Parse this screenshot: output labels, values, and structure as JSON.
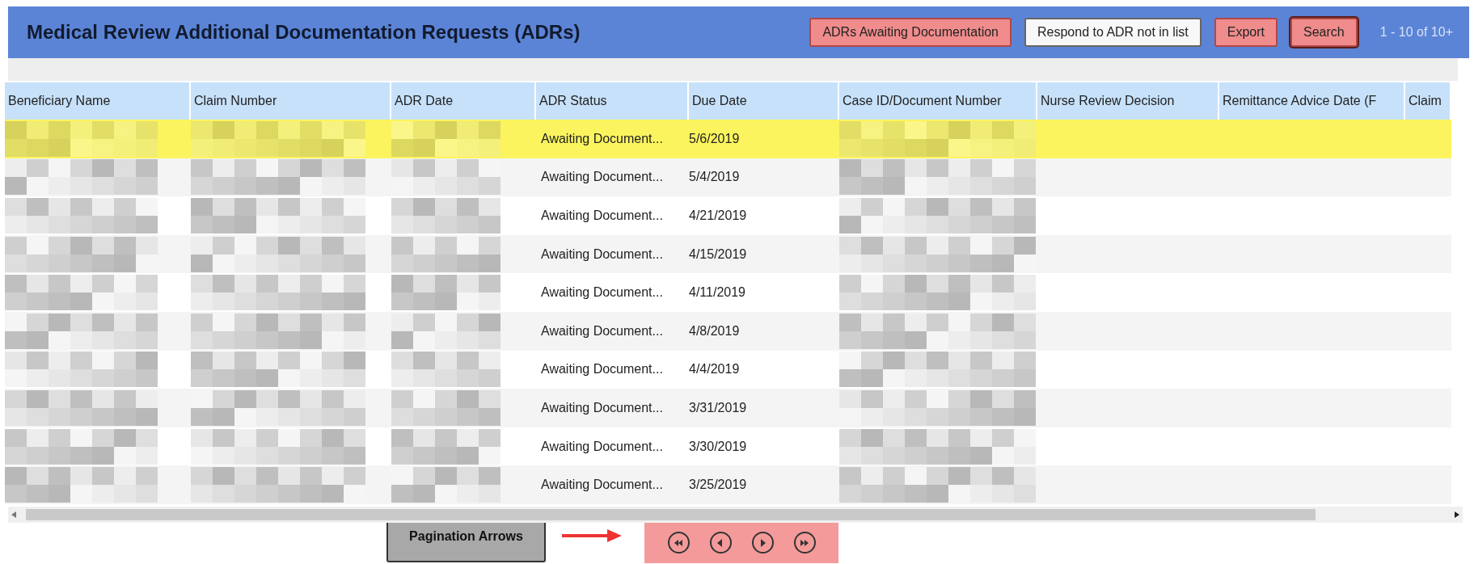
{
  "header": {
    "title": "Medical Review Additional Documentation Requests (ADRs)",
    "buttons": [
      {
        "label": "ADRs Awaiting Documentation",
        "kind": "red"
      },
      {
        "label": "Respond to ADR not in list",
        "kind": "white"
      },
      {
        "label": "Export",
        "kind": "red"
      },
      {
        "label": "Search",
        "kind": "focused"
      }
    ],
    "range": "1 - 10 of 10+"
  },
  "table": {
    "columns": [
      {
        "label": "Beneficiary Name",
        "kind": "redacted"
      },
      {
        "label": "Claim Number",
        "kind": "redacted"
      },
      {
        "label": "ADR Date",
        "kind": "redacted"
      },
      {
        "label": "ADR Status",
        "kind": "status"
      },
      {
        "label": "Due Date",
        "kind": "due"
      },
      {
        "label": "Case ID/Document Number",
        "kind": "redacted"
      },
      {
        "label": "Nurse Review Decision",
        "kind": "empty"
      },
      {
        "label": "Remittance Advice Date (F",
        "kind": "empty"
      },
      {
        "label": "Claim",
        "kind": "empty"
      }
    ],
    "rows": [
      {
        "adr_status": "Awaiting Document...",
        "due_date": "5/6/2019",
        "selected": true
      },
      {
        "adr_status": "Awaiting Document...",
        "due_date": "5/4/2019",
        "selected": false
      },
      {
        "adr_status": "Awaiting Document...",
        "due_date": "4/21/2019",
        "selected": false
      },
      {
        "adr_status": "Awaiting Document...",
        "due_date": "4/15/2019",
        "selected": false
      },
      {
        "adr_status": "Awaiting Document...",
        "due_date": "4/11/2019",
        "selected": false
      },
      {
        "adr_status": "Awaiting Document...",
        "due_date": "4/8/2019",
        "selected": false
      },
      {
        "adr_status": "Awaiting Document...",
        "due_date": "4/4/2019",
        "selected": false
      },
      {
        "adr_status": "Awaiting Document...",
        "due_date": "3/31/2019",
        "selected": false
      },
      {
        "adr_status": "Awaiting Document...",
        "due_date": "3/30/2019",
        "selected": false
      },
      {
        "adr_status": "Awaiting Document...",
        "due_date": "3/25/2019",
        "selected": false
      }
    ]
  },
  "callout": {
    "label": "Pagination Arrows"
  },
  "pagination": [
    {
      "kind": "first"
    },
    {
      "kind": "prev"
    },
    {
      "kind": "next"
    },
    {
      "kind": "last"
    }
  ]
}
